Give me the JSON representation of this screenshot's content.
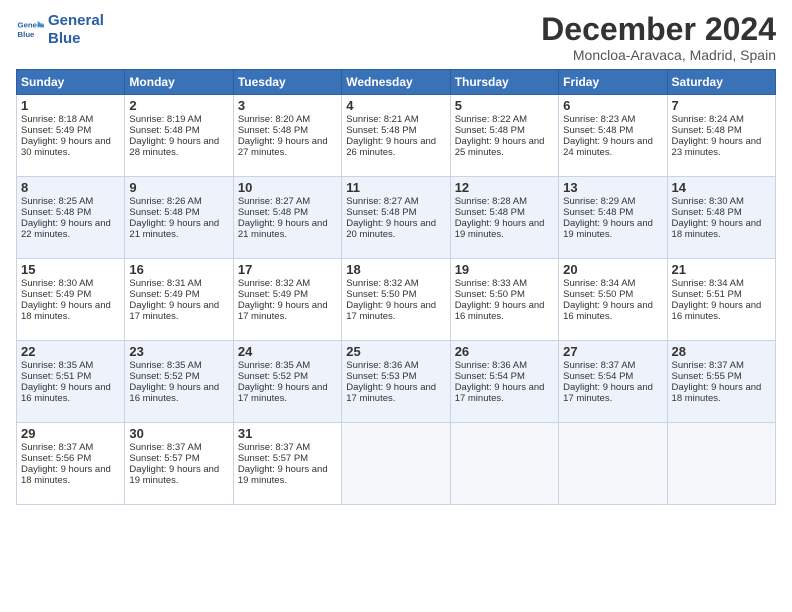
{
  "header": {
    "logo_line1": "General",
    "logo_line2": "Blue",
    "month": "December 2024",
    "location": "Moncloa-Aravaca, Madrid, Spain"
  },
  "days_of_week": [
    "Sunday",
    "Monday",
    "Tuesday",
    "Wednesday",
    "Thursday",
    "Friday",
    "Saturday"
  ],
  "weeks": [
    [
      {
        "day": "1",
        "rise": "Sunrise: 8:18 AM",
        "set": "Sunset: 5:49 PM",
        "light": "Daylight: 9 hours and 30 minutes."
      },
      {
        "day": "2",
        "rise": "Sunrise: 8:19 AM",
        "set": "Sunset: 5:48 PM",
        "light": "Daylight: 9 hours and 28 minutes."
      },
      {
        "day": "3",
        "rise": "Sunrise: 8:20 AM",
        "set": "Sunset: 5:48 PM",
        "light": "Daylight: 9 hours and 27 minutes."
      },
      {
        "day": "4",
        "rise": "Sunrise: 8:21 AM",
        "set": "Sunset: 5:48 PM",
        "light": "Daylight: 9 hours and 26 minutes."
      },
      {
        "day": "5",
        "rise": "Sunrise: 8:22 AM",
        "set": "Sunset: 5:48 PM",
        "light": "Daylight: 9 hours and 25 minutes."
      },
      {
        "day": "6",
        "rise": "Sunrise: 8:23 AM",
        "set": "Sunset: 5:48 PM",
        "light": "Daylight: 9 hours and 24 minutes."
      },
      {
        "day": "7",
        "rise": "Sunrise: 8:24 AM",
        "set": "Sunset: 5:48 PM",
        "light": "Daylight: 9 hours and 23 minutes."
      }
    ],
    [
      {
        "day": "8",
        "rise": "Sunrise: 8:25 AM",
        "set": "Sunset: 5:48 PM",
        "light": "Daylight: 9 hours and 22 minutes."
      },
      {
        "day": "9",
        "rise": "Sunrise: 8:26 AM",
        "set": "Sunset: 5:48 PM",
        "light": "Daylight: 9 hours and 21 minutes."
      },
      {
        "day": "10",
        "rise": "Sunrise: 8:27 AM",
        "set": "Sunset: 5:48 PM",
        "light": "Daylight: 9 hours and 21 minutes."
      },
      {
        "day": "11",
        "rise": "Sunrise: 8:27 AM",
        "set": "Sunset: 5:48 PM",
        "light": "Daylight: 9 hours and 20 minutes."
      },
      {
        "day": "12",
        "rise": "Sunrise: 8:28 AM",
        "set": "Sunset: 5:48 PM",
        "light": "Daylight: 9 hours and 19 minutes."
      },
      {
        "day": "13",
        "rise": "Sunrise: 8:29 AM",
        "set": "Sunset: 5:48 PM",
        "light": "Daylight: 9 hours and 19 minutes."
      },
      {
        "day": "14",
        "rise": "Sunrise: 8:30 AM",
        "set": "Sunset: 5:48 PM",
        "light": "Daylight: 9 hours and 18 minutes."
      }
    ],
    [
      {
        "day": "15",
        "rise": "Sunrise: 8:30 AM",
        "set": "Sunset: 5:49 PM",
        "light": "Daylight: 9 hours and 18 minutes."
      },
      {
        "day": "16",
        "rise": "Sunrise: 8:31 AM",
        "set": "Sunset: 5:49 PM",
        "light": "Daylight: 9 hours and 17 minutes."
      },
      {
        "day": "17",
        "rise": "Sunrise: 8:32 AM",
        "set": "Sunset: 5:49 PM",
        "light": "Daylight: 9 hours and 17 minutes."
      },
      {
        "day": "18",
        "rise": "Sunrise: 8:32 AM",
        "set": "Sunset: 5:50 PM",
        "light": "Daylight: 9 hours and 17 minutes."
      },
      {
        "day": "19",
        "rise": "Sunrise: 8:33 AM",
        "set": "Sunset: 5:50 PM",
        "light": "Daylight: 9 hours and 16 minutes."
      },
      {
        "day": "20",
        "rise": "Sunrise: 8:34 AM",
        "set": "Sunset: 5:50 PM",
        "light": "Daylight: 9 hours and 16 minutes."
      },
      {
        "day": "21",
        "rise": "Sunrise: 8:34 AM",
        "set": "Sunset: 5:51 PM",
        "light": "Daylight: 9 hours and 16 minutes."
      }
    ],
    [
      {
        "day": "22",
        "rise": "Sunrise: 8:35 AM",
        "set": "Sunset: 5:51 PM",
        "light": "Daylight: 9 hours and 16 minutes."
      },
      {
        "day": "23",
        "rise": "Sunrise: 8:35 AM",
        "set": "Sunset: 5:52 PM",
        "light": "Daylight: 9 hours and 16 minutes."
      },
      {
        "day": "24",
        "rise": "Sunrise: 8:35 AM",
        "set": "Sunset: 5:52 PM",
        "light": "Daylight: 9 hours and 17 minutes."
      },
      {
        "day": "25",
        "rise": "Sunrise: 8:36 AM",
        "set": "Sunset: 5:53 PM",
        "light": "Daylight: 9 hours and 17 minutes."
      },
      {
        "day": "26",
        "rise": "Sunrise: 8:36 AM",
        "set": "Sunset: 5:54 PM",
        "light": "Daylight: 9 hours and 17 minutes."
      },
      {
        "day": "27",
        "rise": "Sunrise: 8:37 AM",
        "set": "Sunset: 5:54 PM",
        "light": "Daylight: 9 hours and 17 minutes."
      },
      {
        "day": "28",
        "rise": "Sunrise: 8:37 AM",
        "set": "Sunset: 5:55 PM",
        "light": "Daylight: 9 hours and 18 minutes."
      }
    ],
    [
      {
        "day": "29",
        "rise": "Sunrise: 8:37 AM",
        "set": "Sunset: 5:56 PM",
        "light": "Daylight: 9 hours and 18 minutes."
      },
      {
        "day": "30",
        "rise": "Sunrise: 8:37 AM",
        "set": "Sunset: 5:57 PM",
        "light": "Daylight: 9 hours and 19 minutes."
      },
      {
        "day": "31",
        "rise": "Sunrise: 8:37 AM",
        "set": "Sunset: 5:57 PM",
        "light": "Daylight: 9 hours and 19 minutes."
      },
      null,
      null,
      null,
      null
    ]
  ]
}
